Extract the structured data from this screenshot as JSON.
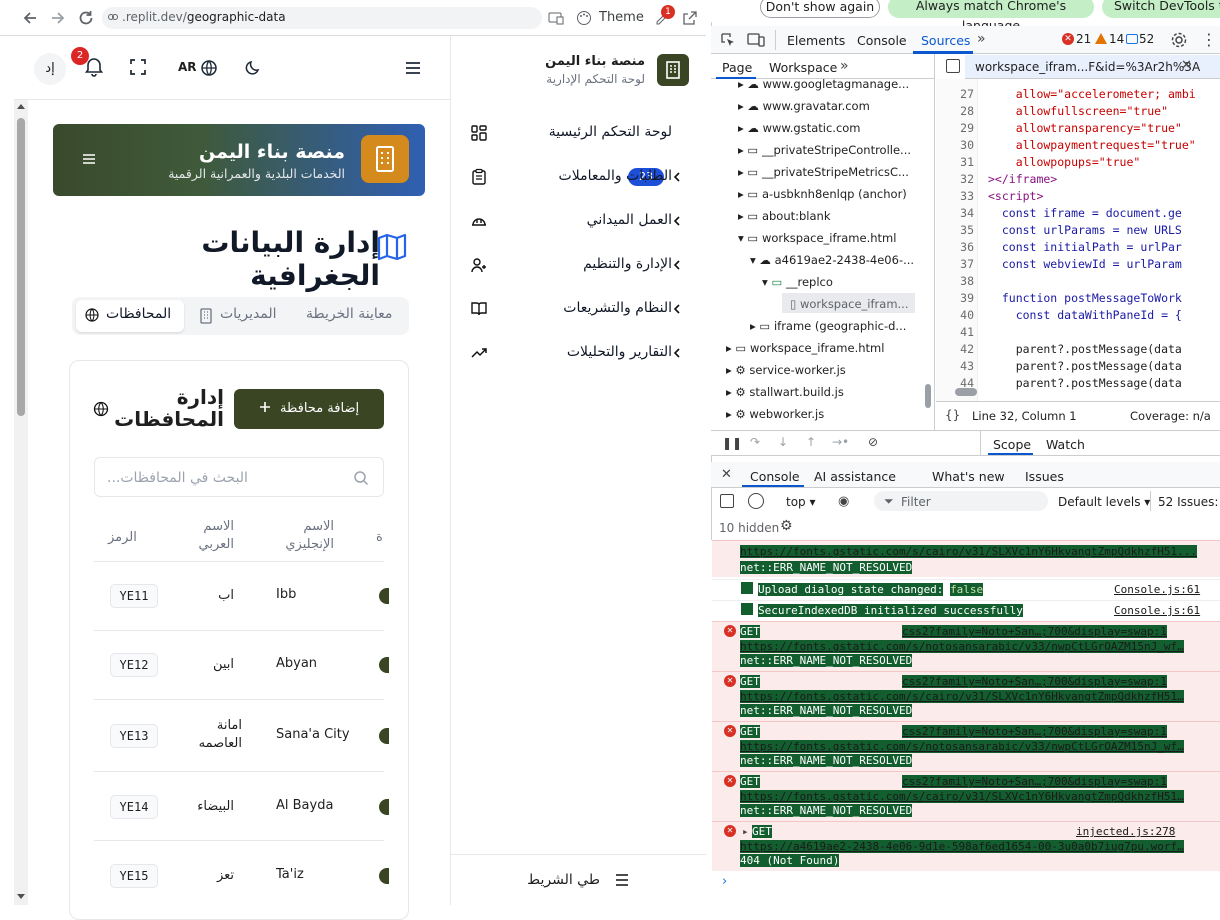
{
  "browser": {
    "url_prefix": ".replit.dev/",
    "url_path": "geographic-data",
    "theme_label": "Theme",
    "ext_badge": "1"
  },
  "topbar": {
    "avatar_initials": "إد",
    "notif_count": "2",
    "lang_label": "AR"
  },
  "sidebar": {
    "brand_title": "منصة بناء اليمن",
    "brand_subtitle": "لوحة التحكم الإدارية",
    "items": [
      {
        "label": "لوحة التحكم الرئيسية",
        "icon": "dashboard-icon"
      },
      {
        "label": "الطلبات والمعاملات",
        "icon": "clipboard-icon",
        "badge": "23"
      },
      {
        "label": "العمل الميداني",
        "icon": "hardhat-icon"
      },
      {
        "label": "الإدارة والتنظيم",
        "icon": "users-icon"
      },
      {
        "label": "النظام والتشريعات",
        "icon": "book-icon"
      },
      {
        "label": "التقارير والتحليلات",
        "icon": "trending-icon"
      }
    ],
    "collapse_label": "طي الشريط"
  },
  "banner": {
    "title": "منصة بناء اليمن",
    "subtitle": "الخدمات البلدية والعمرانية الرقمية"
  },
  "main": {
    "title": "إدارة البيانات الجغرافية",
    "tabs": [
      "معاينة الخريطة",
      "المديريات",
      "المحافظات"
    ],
    "card_title": "إدارة المحافظات",
    "add_button": "إضافة محافظة",
    "search_placeholder": "البحث في المحافظات...",
    "columns": [
      "الرمز",
      "الاسم العربي",
      "الاسم الإنجليزي",
      "ة"
    ],
    "rows": [
      {
        "code": "YE11",
        "ar": "اب",
        "en": "Ibb"
      },
      {
        "code": "YE12",
        "ar": "ابين",
        "en": "Abyan"
      },
      {
        "code": "YE13",
        "ar": "امانة العاصمه",
        "en": "Sana'a City"
      },
      {
        "code": "YE14",
        "ar": "البيضاء",
        "en": "Al Bayda"
      },
      {
        "code": "YE15",
        "ar": "تعز",
        "en": "Ta'iz"
      }
    ]
  },
  "devtools": {
    "infobar": [
      "Don't show again",
      "Always match Chrome's language",
      "Switch DevTools to"
    ],
    "tabs": [
      "Elements",
      "Console",
      "Sources"
    ],
    "errors": "21",
    "warnings": "14",
    "messages": "52",
    "sources_subtabs": [
      "Page",
      "Workspace"
    ],
    "open_file": "workspace_ifram...F&id=%3Ar2h%3A",
    "tree": [
      "www.googletagmanage...",
      "www.gravatar.com",
      "www.gstatic.com",
      "__privateStripeControlle...",
      "__privateStripeMetricsC...",
      "a-usbknh8enlqp (anchor)",
      "about:blank",
      "workspace_iframe.html",
      "a4619ae2-2438-4e06-...",
      "__replco",
      "workspace_ifram...",
      "iframe (geographic-d...",
      "workspace_iframe.html",
      "service-worker.js",
      "stallwart.build.js",
      "webworker.js"
    ],
    "code_lines": [
      {
        "n": "27",
        "t": "    allow=\"accelerometer; ambi"
      },
      {
        "n": "28",
        "t": "    allowfullscreen=\"true\""
      },
      {
        "n": "29",
        "t": "    allowtransparency=\"true\""
      },
      {
        "n": "30",
        "t": "    allowpaymentrequest=\"true\""
      },
      {
        "n": "31",
        "t": "    allowpopups=\"true\""
      },
      {
        "n": "32",
        "t": "></iframe>"
      },
      {
        "n": "33",
        "t": "<script>"
      },
      {
        "n": "34",
        "t": "  const iframe = document.ge"
      },
      {
        "n": "35",
        "t": "  const urlParams = new URLS"
      },
      {
        "n": "36",
        "t": "  const initialPath = urlPar"
      },
      {
        "n": "37",
        "t": "  const webviewId = urlParam"
      },
      {
        "n": "38",
        "t": ""
      },
      {
        "n": "39",
        "t": "  function postMessageToWork"
      },
      {
        "n": "40",
        "t": "    const dataWithPaneId = {"
      },
      {
        "n": "41",
        "t": ""
      },
      {
        "n": "42",
        "t": "    parent?.postMessage(data"
      },
      {
        "n": "43",
        "t": "    parent?.postMessage(data"
      },
      {
        "n": "44",
        "t": "    parent?.postMessage(data"
      }
    ],
    "status_pos": "Line 32, Column 1",
    "coverage": "Coverage: n/a",
    "scope_tabs": [
      "Scope",
      "Watch"
    ],
    "drawer_tabs": [
      "Console",
      "AI assistance",
      "What's new",
      "Issues"
    ],
    "context": "top",
    "filter_placeholder": "Filter",
    "levels": "Default levels",
    "issues": "52 Issues:",
    "hidden": "10 hidden",
    "console": {
      "first_url": "https://fonts.gstatic.com/s/cairo/v31/SLXVc1nY6HkvangtZmpQdkhzfH51...",
      "first_err": "net::ERR_NAME_NOT_RESOLVED",
      "info1": "Upload dialog state changed:",
      "info1_val": "false",
      "info1_src": "Console.js:61",
      "info2": "SecureIndexedDB initialized successfully",
      "info2_src": "Console.js:61",
      "get": "GET",
      "css_src": "css2?family=Noto+San…;700&display=swap:1",
      "css_src_alt": "css2?family=Noto+San…;700&display=swap:1",
      "url_noto": "https://fonts.gstatic.com/s/notosansarabic/v33/nwpCtLGrOAZM15nJ_wf…",
      "url_cairo": "https://fonts.gstatic.com/s/cairo/v31/SLXVc1nY6HkvangtZmpQdkhzfH51…",
      "err": "net::ERR_NAME_NOT_RESOLVED",
      "injected_src": "injected.js:278",
      "last_url": "https://a4619ae2-2438-4e06-9d1e-598af6ed1654-00-3u0a0b7iug7pu.worf…",
      "last_err": "404 (Not Found)"
    }
  },
  "colors": {
    "brand_dark": "#3a4524",
    "brand_orange": "#d48a1c",
    "badge_blue": "#1d4ed8"
  }
}
